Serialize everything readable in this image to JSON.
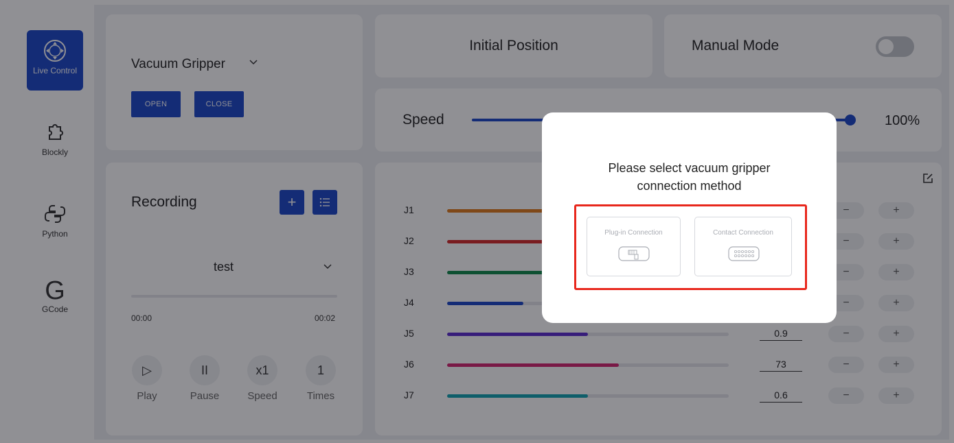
{
  "sidebar": {
    "items": [
      {
        "label": "Live Control",
        "icon": "live-control-icon",
        "active": true
      },
      {
        "label": "Blockly",
        "icon": "puzzle-icon",
        "active": false
      },
      {
        "label": "Python",
        "icon": "python-icon",
        "active": false
      },
      {
        "label": "GCode",
        "icon": "gcode-icon",
        "glyph": "G",
        "active": false
      }
    ]
  },
  "gripper": {
    "title": "Vacuum Gripper",
    "open_label": "OPEN",
    "close_label": "CLOSE"
  },
  "recording": {
    "title": "Recording",
    "selected": "test",
    "time_start": "00:00",
    "time_end": "00:02",
    "controls": [
      {
        "glyph": "▷",
        "label": "Play",
        "icon": "play-icon"
      },
      {
        "glyph": "II",
        "label": "Pause",
        "icon": "pause-icon"
      },
      {
        "glyph": "x1",
        "label": "Speed",
        "icon": "speed-multiplier"
      },
      {
        "glyph": "1",
        "label": "Times",
        "icon": "times-count"
      }
    ]
  },
  "initial_position": {
    "label": "Initial Position"
  },
  "manual_mode": {
    "label": "Manual Mode",
    "enabled": false
  },
  "speed": {
    "label": "Speed",
    "value_text": "100%",
    "fraction": 1.0
  },
  "joints": [
    {
      "label": "J1",
      "value": "",
      "color": "#e07b1a",
      "fill": 0.45
    },
    {
      "label": "J2",
      "value": "",
      "color": "#d42a2a",
      "fill": 0.45
    },
    {
      "label": "J3",
      "value": "",
      "color": "#0f8a4a",
      "fill": 0.45
    },
    {
      "label": "J4",
      "value": "",
      "color": "#1b46c8",
      "fill": 0.27
    },
    {
      "label": "J5",
      "value": "0.9",
      "color": "#5b2bd0",
      "fill": 0.5
    },
    {
      "label": "J6",
      "value": "73",
      "color": "#d4236f",
      "fill": 0.61
    },
    {
      "label": "J7",
      "value": "0.6",
      "color": "#0fa3b1",
      "fill": 0.5
    }
  ],
  "joint_buttons": {
    "minus": "−",
    "plus": "+"
  },
  "dialog": {
    "title": "Please select vacuum gripper connection method",
    "options": [
      {
        "label": "Plug-in Connection",
        "icon": "plug-icon"
      },
      {
        "label": "Contact Connection",
        "icon": "contact-pins-icon"
      }
    ],
    "highlight_color": "#e8271c"
  }
}
